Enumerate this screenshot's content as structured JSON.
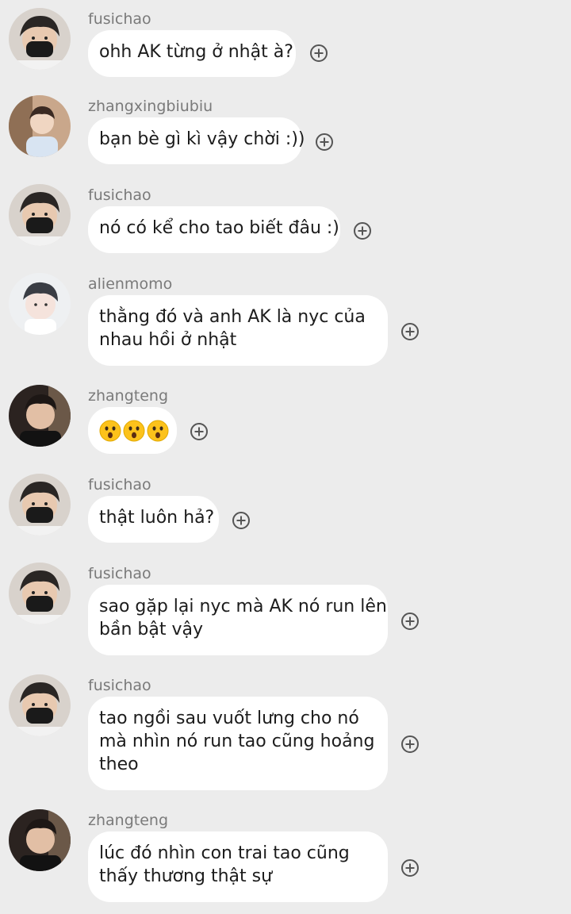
{
  "messages": [
    {
      "user": "fusichao",
      "text": "ohh AK từng ở nhật à?",
      "avatar": "fusichao-avatar"
    },
    {
      "user": "zhangxingbiubiu",
      "text": "bạn bè gì kì vậy chời :))",
      "avatar": "zhangxingbiubiu-avatar"
    },
    {
      "user": "fusichao",
      "text": "nó có kể cho tao biết đâu :)",
      "avatar": "fusichao-avatar"
    },
    {
      "user": "alienmomo",
      "lines": [
        "thằng đó và anh AK là nyc của",
        "nhau hồi ở nhật"
      ],
      "avatar": "alienmomo-avatar"
    },
    {
      "user": "zhangteng",
      "emoji": "hushed-face-emoji x3",
      "avatar": "zhangteng-avatar"
    },
    {
      "user": "fusichao",
      "text": "thật luôn hả?",
      "avatar": "fusichao-avatar"
    },
    {
      "user": "fusichao",
      "lines": [
        "sao gặp lại nyc mà AK nó run lên",
        "bần bật vậy"
      ],
      "avatar": "fusichao-avatar"
    },
    {
      "user": "fusichao",
      "lines": [
        "tao ngồi sau vuốt lưng cho nó",
        "mà nhìn nó run tao cũng hoảng",
        "theo"
      ],
      "avatar": "fusichao-avatar"
    },
    {
      "user": "zhangteng",
      "lines": [
        "lúc đó nhìn con trai tao cũng",
        "thấy thương thật sự"
      ],
      "avatar": "zhangteng-avatar"
    }
  ],
  "colors": {
    "background": "#ececec",
    "bubble": "#ffffff",
    "username": "#7a7a7a",
    "text": "#1c1c1c"
  }
}
